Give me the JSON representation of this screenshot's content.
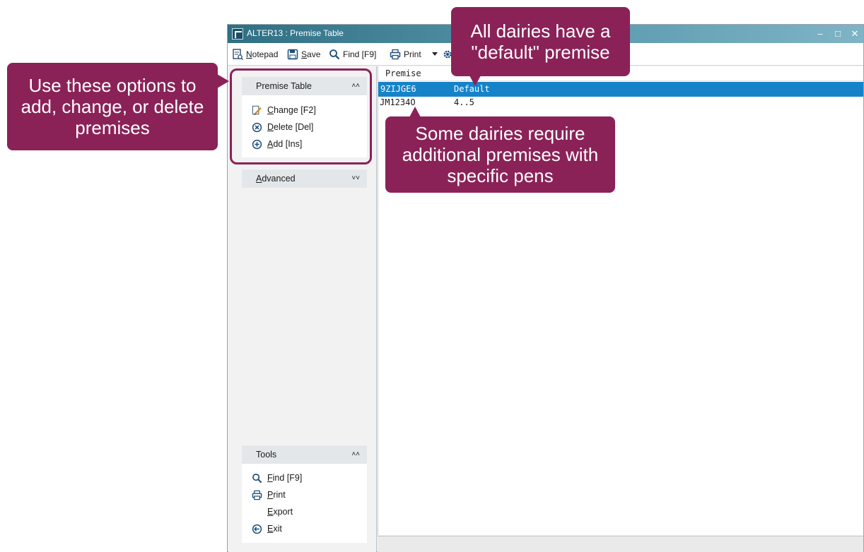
{
  "window": {
    "title": "ALTER13 : Premise Table",
    "controls": {
      "minimize": "–",
      "maximize": "□",
      "close": "✕"
    }
  },
  "toolbar": {
    "notepad": {
      "first": "N",
      "rest": "otepad",
      "icon": "notepad-icon"
    },
    "save": {
      "first": "S",
      "rest": "ave",
      "icon": "save-icon"
    },
    "find": {
      "label": "Find [F9]",
      "icon": "search-icon"
    },
    "print": {
      "label": "Print",
      "icon": "printer-icon"
    },
    "settings": {
      "icon": "gear-icon"
    }
  },
  "taskpane": {
    "premise_group": {
      "title": "Premise Table",
      "items": [
        {
          "first": "C",
          "rest": "hange [F2]",
          "icon": "edit-icon"
        },
        {
          "first": "D",
          "rest": "elete [Del]",
          "icon": "delete-icon"
        },
        {
          "first": "A",
          "rest": "dd [Ins]",
          "icon": "add-icon"
        }
      ]
    },
    "advanced_group": {
      "first": "A",
      "rest": "dvanced"
    },
    "tools_group": {
      "title": "Tools",
      "items": [
        {
          "first": "F",
          "rest": "ind [F9]",
          "icon": "search-icon"
        },
        {
          "first": "P",
          "rest": "rint",
          "icon": "printer-icon"
        },
        {
          "first": "E",
          "rest": "xport",
          "icon": ""
        },
        {
          "first": "E",
          "rest": "xit",
          "icon": "exit-icon"
        }
      ]
    }
  },
  "grid": {
    "columns": [
      "Premise",
      ""
    ],
    "rows": [
      {
        "premise": "9ZIJGE6",
        "pens": "Default",
        "selected": true
      },
      {
        "premise": "JM1234O",
        "pens": "4..5",
        "selected": false
      }
    ]
  },
  "callouts": {
    "options": "Use these options to add, change, or delete premises",
    "default": "All dairies have a \"default\" premise",
    "additional": "Some dairies require additional premises with specific pens"
  },
  "colors": {
    "callout": "#8a2258",
    "selection": "#1683c9",
    "titlebar": "#2f6f84"
  }
}
